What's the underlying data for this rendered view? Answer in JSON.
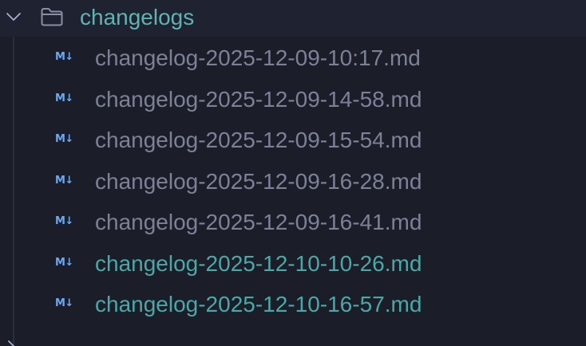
{
  "folder": {
    "name": "changelogs",
    "expanded": true,
    "icon": "folder-icon",
    "chevron": "chevron-down-icon"
  },
  "files": [
    {
      "icon_text": "M↓",
      "name": "changelog-2025-12-09-10:17.md",
      "status": "default"
    },
    {
      "icon_text": "M↓",
      "name": "changelog-2025-12-09-14-58.md",
      "status": "default"
    },
    {
      "icon_text": "M↓",
      "name": "changelog-2025-12-09-15-54.md",
      "status": "default"
    },
    {
      "icon_text": "M↓",
      "name": "changelog-2025-12-09-16-28.md",
      "status": "default"
    },
    {
      "icon_text": "M↓",
      "name": "changelog-2025-12-09-16-41.md",
      "status": "default"
    },
    {
      "icon_text": "M↓",
      "name": "changelog-2025-12-10-10-26.md",
      "status": "untracked"
    },
    {
      "icon_text": "M↓",
      "name": "changelog-2025-12-10-16-57.md",
      "status": "untracked"
    }
  ],
  "colors": {
    "background": "#1b1e28",
    "header_background": "#1f2230",
    "folder_label": "#5fb3b3",
    "file_default": "#7d8197",
    "file_untracked": "#4aa8a8",
    "md_icon": "#6fa8ef",
    "guide_line": "#2a2e3c",
    "chevron": "#a6accd"
  }
}
